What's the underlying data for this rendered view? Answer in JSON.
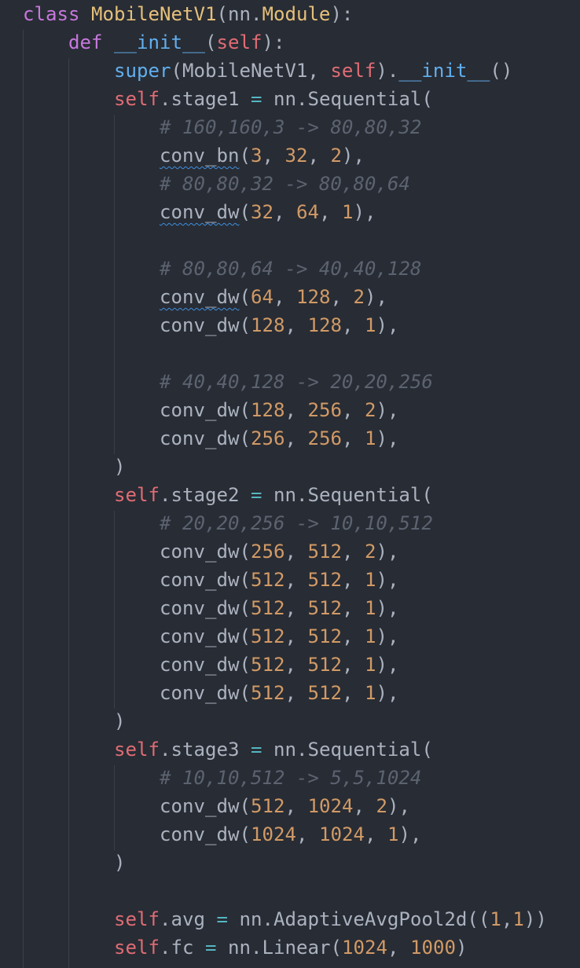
{
  "editor": {
    "language": "python",
    "colors": {
      "background": "#282c34",
      "text": "#abb2bf",
      "keyword": "#c678dd",
      "class_name": "#e5c07b",
      "function": "#61afef",
      "self": "#e06c75",
      "number": "#d19a66",
      "comment": "#5c6370",
      "operator": "#56b6c2",
      "indent_guide": "#3b4048",
      "squiggle": "#3e8fe0"
    },
    "lines": [
      [
        {
          "t": "class",
          "c": "kw"
        },
        {
          "t": " ",
          "c": "plain"
        },
        {
          "t": "MobileNetV1",
          "c": "cls"
        },
        {
          "t": "(nn.",
          "c": "plain"
        },
        {
          "t": "Module",
          "c": "cls"
        },
        {
          "t": "):",
          "c": "plain"
        }
      ],
      [
        {
          "t": "    ",
          "c": "plain"
        },
        {
          "t": "def",
          "c": "kw"
        },
        {
          "t": " ",
          "c": "plain"
        },
        {
          "t": "__init__",
          "c": "fn"
        },
        {
          "t": "(",
          "c": "plain"
        },
        {
          "t": "self",
          "c": "self"
        },
        {
          "t": "):",
          "c": "plain"
        }
      ],
      [
        {
          "t": "        ",
          "c": "plain"
        },
        {
          "t": "super",
          "c": "fn"
        },
        {
          "t": "(MobileNetV1, ",
          "c": "plain"
        },
        {
          "t": "self",
          "c": "self"
        },
        {
          "t": ").",
          "c": "plain"
        },
        {
          "t": "__init__",
          "c": "fn"
        },
        {
          "t": "()",
          "c": "plain"
        }
      ],
      [
        {
          "t": "        ",
          "c": "plain"
        },
        {
          "t": "self",
          "c": "self"
        },
        {
          "t": ".stage1 ",
          "c": "plain"
        },
        {
          "t": "=",
          "c": "op"
        },
        {
          "t": " nn.Sequential(",
          "c": "plain"
        }
      ],
      [
        {
          "t": "            ",
          "c": "plain"
        },
        {
          "t": "# 160,160,3 -> 80,80,32",
          "c": "cmt"
        }
      ],
      [
        {
          "t": "            ",
          "c": "plain"
        },
        {
          "t": "conv_bn",
          "c": "plain",
          "sq": true
        },
        {
          "t": "(",
          "c": "plain"
        },
        {
          "t": "3",
          "c": "num"
        },
        {
          "t": ", ",
          "c": "plain"
        },
        {
          "t": "32",
          "c": "num"
        },
        {
          "t": ", ",
          "c": "plain"
        },
        {
          "t": "2",
          "c": "num"
        },
        {
          "t": "),",
          "c": "plain"
        }
      ],
      [
        {
          "t": "            ",
          "c": "plain"
        },
        {
          "t": "# 80,80,32 -> 80,80,64",
          "c": "cmt"
        }
      ],
      [
        {
          "t": "            ",
          "c": "plain"
        },
        {
          "t": "conv_dw",
          "c": "plain",
          "sq": true
        },
        {
          "t": "(",
          "c": "plain"
        },
        {
          "t": "32",
          "c": "num"
        },
        {
          "t": ", ",
          "c": "plain"
        },
        {
          "t": "64",
          "c": "num"
        },
        {
          "t": ", ",
          "c": "plain"
        },
        {
          "t": "1",
          "c": "num"
        },
        {
          "t": "),",
          "c": "plain"
        }
      ],
      [],
      [
        {
          "t": "            ",
          "c": "plain"
        },
        {
          "t": "# 80,80,64 -> 40,40,128",
          "c": "cmt"
        }
      ],
      [
        {
          "t": "            ",
          "c": "plain"
        },
        {
          "t": "conv_dw",
          "c": "plain",
          "sq": true
        },
        {
          "t": "(",
          "c": "plain"
        },
        {
          "t": "64",
          "c": "num"
        },
        {
          "t": ", ",
          "c": "plain"
        },
        {
          "t": "128",
          "c": "num"
        },
        {
          "t": ", ",
          "c": "plain"
        },
        {
          "t": "2",
          "c": "num"
        },
        {
          "t": "),",
          "c": "plain"
        }
      ],
      [
        {
          "t": "            ",
          "c": "plain"
        },
        {
          "t": "conv_dw(",
          "c": "plain"
        },
        {
          "t": "128",
          "c": "num"
        },
        {
          "t": ", ",
          "c": "plain"
        },
        {
          "t": "128",
          "c": "num"
        },
        {
          "t": ", ",
          "c": "plain"
        },
        {
          "t": "1",
          "c": "num"
        },
        {
          "t": "),",
          "c": "plain"
        }
      ],
      [],
      [
        {
          "t": "            ",
          "c": "plain"
        },
        {
          "t": "# 40,40,128 -> 20,20,256",
          "c": "cmt"
        }
      ],
      [
        {
          "t": "            ",
          "c": "plain"
        },
        {
          "t": "conv_dw(",
          "c": "plain"
        },
        {
          "t": "128",
          "c": "num"
        },
        {
          "t": ", ",
          "c": "plain"
        },
        {
          "t": "256",
          "c": "num"
        },
        {
          "t": ", ",
          "c": "plain"
        },
        {
          "t": "2",
          "c": "num"
        },
        {
          "t": "),",
          "c": "plain"
        }
      ],
      [
        {
          "t": "            ",
          "c": "plain"
        },
        {
          "t": "conv_dw(",
          "c": "plain"
        },
        {
          "t": "256",
          "c": "num"
        },
        {
          "t": ", ",
          "c": "plain"
        },
        {
          "t": "256",
          "c": "num"
        },
        {
          "t": ", ",
          "c": "plain"
        },
        {
          "t": "1",
          "c": "num"
        },
        {
          "t": "),",
          "c": "plain"
        }
      ],
      [
        {
          "t": "        ",
          "c": "plain"
        },
        {
          "t": ")",
          "c": "plain"
        }
      ],
      [
        {
          "t": "        ",
          "c": "plain"
        },
        {
          "t": "self",
          "c": "self"
        },
        {
          "t": ".stage2 ",
          "c": "plain"
        },
        {
          "t": "=",
          "c": "op"
        },
        {
          "t": " nn.Sequential(",
          "c": "plain"
        }
      ],
      [
        {
          "t": "            ",
          "c": "plain"
        },
        {
          "t": "# 20,20,256 -> 10,10,512",
          "c": "cmt"
        }
      ],
      [
        {
          "t": "            ",
          "c": "plain"
        },
        {
          "t": "conv_dw(",
          "c": "plain"
        },
        {
          "t": "256",
          "c": "num"
        },
        {
          "t": ", ",
          "c": "plain"
        },
        {
          "t": "512",
          "c": "num"
        },
        {
          "t": ", ",
          "c": "plain"
        },
        {
          "t": "2",
          "c": "num"
        },
        {
          "t": "),",
          "c": "plain"
        }
      ],
      [
        {
          "t": "            ",
          "c": "plain"
        },
        {
          "t": "conv_dw(",
          "c": "plain"
        },
        {
          "t": "512",
          "c": "num"
        },
        {
          "t": ", ",
          "c": "plain"
        },
        {
          "t": "512",
          "c": "num"
        },
        {
          "t": ", ",
          "c": "plain"
        },
        {
          "t": "1",
          "c": "num"
        },
        {
          "t": "),",
          "c": "plain"
        }
      ],
      [
        {
          "t": "            ",
          "c": "plain"
        },
        {
          "t": "conv_dw(",
          "c": "plain"
        },
        {
          "t": "512",
          "c": "num"
        },
        {
          "t": ", ",
          "c": "plain"
        },
        {
          "t": "512",
          "c": "num"
        },
        {
          "t": ", ",
          "c": "plain"
        },
        {
          "t": "1",
          "c": "num"
        },
        {
          "t": "),",
          "c": "plain"
        }
      ],
      [
        {
          "t": "            ",
          "c": "plain"
        },
        {
          "t": "conv_dw(",
          "c": "plain"
        },
        {
          "t": "512",
          "c": "num"
        },
        {
          "t": ", ",
          "c": "plain"
        },
        {
          "t": "512",
          "c": "num"
        },
        {
          "t": ", ",
          "c": "plain"
        },
        {
          "t": "1",
          "c": "num"
        },
        {
          "t": "),",
          "c": "plain"
        }
      ],
      [
        {
          "t": "            ",
          "c": "plain"
        },
        {
          "t": "conv_dw(",
          "c": "plain"
        },
        {
          "t": "512",
          "c": "num"
        },
        {
          "t": ", ",
          "c": "plain"
        },
        {
          "t": "512",
          "c": "num"
        },
        {
          "t": ", ",
          "c": "plain"
        },
        {
          "t": "1",
          "c": "num"
        },
        {
          "t": "),",
          "c": "plain"
        }
      ],
      [
        {
          "t": "            ",
          "c": "plain"
        },
        {
          "t": "conv_dw(",
          "c": "plain"
        },
        {
          "t": "512",
          "c": "num"
        },
        {
          "t": ", ",
          "c": "plain"
        },
        {
          "t": "512",
          "c": "num"
        },
        {
          "t": ", ",
          "c": "plain"
        },
        {
          "t": "1",
          "c": "num"
        },
        {
          "t": "),",
          "c": "plain"
        }
      ],
      [
        {
          "t": "        ",
          "c": "plain"
        },
        {
          "t": ")",
          "c": "plain"
        }
      ],
      [
        {
          "t": "        ",
          "c": "plain"
        },
        {
          "t": "self",
          "c": "self"
        },
        {
          "t": ".stage3 ",
          "c": "plain"
        },
        {
          "t": "=",
          "c": "op"
        },
        {
          "t": " nn.Sequential(",
          "c": "plain"
        }
      ],
      [
        {
          "t": "            ",
          "c": "plain"
        },
        {
          "t": "# 10,10,512 -> 5,5,1024",
          "c": "cmt"
        }
      ],
      [
        {
          "t": "            ",
          "c": "plain"
        },
        {
          "t": "conv_dw(",
          "c": "plain"
        },
        {
          "t": "512",
          "c": "num"
        },
        {
          "t": ", ",
          "c": "plain"
        },
        {
          "t": "1024",
          "c": "num"
        },
        {
          "t": ", ",
          "c": "plain"
        },
        {
          "t": "2",
          "c": "num"
        },
        {
          "t": "),",
          "c": "plain"
        }
      ],
      [
        {
          "t": "            ",
          "c": "plain"
        },
        {
          "t": "conv_dw(",
          "c": "plain"
        },
        {
          "t": "1024",
          "c": "num"
        },
        {
          "t": ", ",
          "c": "plain"
        },
        {
          "t": "1024",
          "c": "num"
        },
        {
          "t": ", ",
          "c": "plain"
        },
        {
          "t": "1",
          "c": "num"
        },
        {
          "t": "),",
          "c": "plain"
        }
      ],
      [
        {
          "t": "        ",
          "c": "plain"
        },
        {
          "t": ")",
          "c": "plain"
        }
      ],
      [],
      [
        {
          "t": "        ",
          "c": "plain"
        },
        {
          "t": "self",
          "c": "self"
        },
        {
          "t": ".avg ",
          "c": "plain"
        },
        {
          "t": "=",
          "c": "op"
        },
        {
          "t": " nn.AdaptiveAvgPool2d((",
          "c": "plain"
        },
        {
          "t": "1",
          "c": "num"
        },
        {
          "t": ",",
          "c": "plain"
        },
        {
          "t": "1",
          "c": "num"
        },
        {
          "t": "))",
          "c": "plain"
        }
      ],
      [
        {
          "t": "        ",
          "c": "plain"
        },
        {
          "t": "self",
          "c": "self"
        },
        {
          "t": ".fc ",
          "c": "plain"
        },
        {
          "t": "=",
          "c": "op"
        },
        {
          "t": " nn.Linear(",
          "c": "plain"
        },
        {
          "t": "1024",
          "c": "num"
        },
        {
          "t": ", ",
          "c": "plain"
        },
        {
          "t": "1000",
          "c": "num"
        },
        {
          "t": ")",
          "c": "plain"
        }
      ]
    ]
  }
}
